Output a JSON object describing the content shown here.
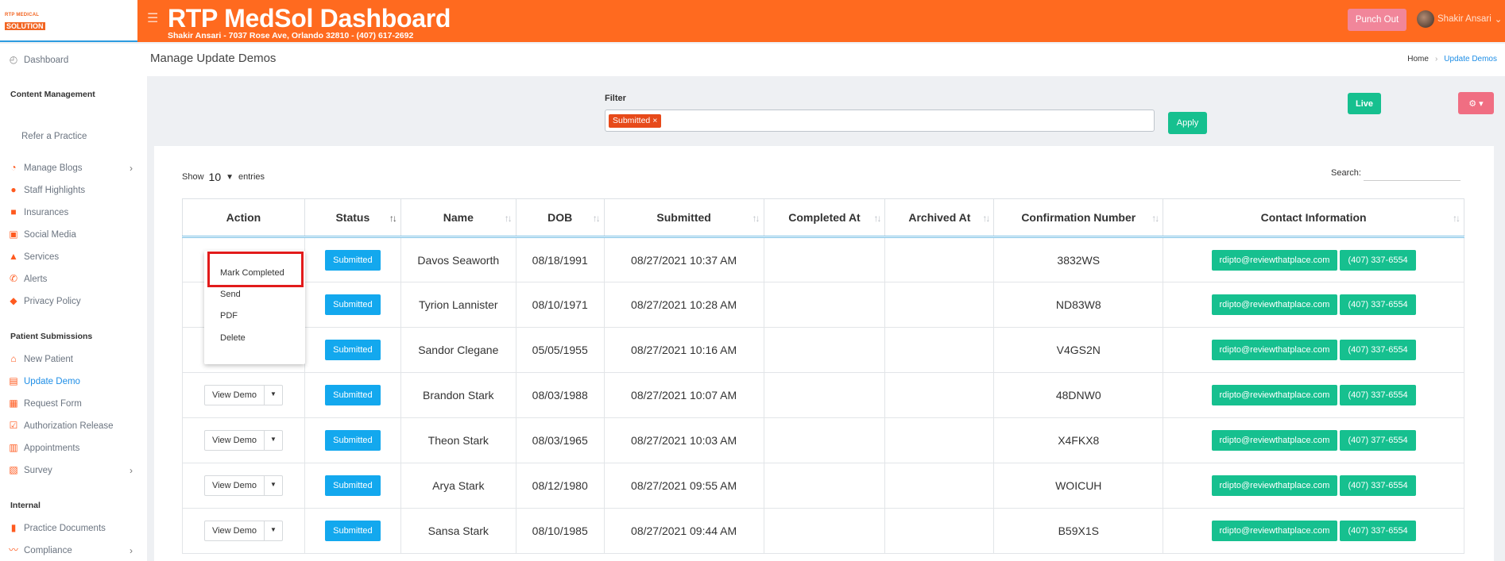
{
  "brand": {
    "logo_top": "RTP MEDICAL",
    "logo_bottom": "SOLUTION",
    "primary_color": "#ff6a1f",
    "accent_blue": "#1e8ee6",
    "green": "#16c08f"
  },
  "header": {
    "title": "RTP MedSol Dashboard",
    "subtitle": "Shakir Ansari - 7037 Rose Ave, Orlando 32810 - (407) 617-2692",
    "punch_label": "Punch Out",
    "user_name": "Shakir Ansari"
  },
  "sidebar": {
    "dashboard": "Dashboard",
    "section_content": "Content Management",
    "refer": "Refer a Practice",
    "items_content": [
      "Manage Blogs",
      "Staff Highlights",
      "Insurances",
      "Social Media",
      "Services",
      "Alerts",
      "Privacy Policy"
    ],
    "section_patient": "Patient Submissions",
    "items_patient": [
      "New Patient",
      "Update Demo",
      "Request Form",
      "Authorization Release",
      "Appointments",
      "Survey"
    ],
    "section_internal": "Internal",
    "items_internal": [
      "Practice Documents",
      "Compliance"
    ]
  },
  "page": {
    "title": "Manage Update Demos",
    "breadcrumb": [
      "Home",
      "Update Demos"
    ]
  },
  "filter": {
    "label": "Filter",
    "tag": "Submitted ×",
    "apply": "Apply",
    "live": "Live",
    "gear": "⚙ ▾"
  },
  "table_controls": {
    "show": "Show",
    "entries_value": "10",
    "entries": "entries",
    "search_label": "Search:"
  },
  "table": {
    "columns": [
      "Action",
      "Status",
      "Name",
      "DOB",
      "Submitted",
      "Completed At",
      "Archived At",
      "Confirmation Number",
      "Contact Information"
    ],
    "view_label": "View Demo",
    "rows": [
      {
        "status": "Submitted",
        "name": "Davos Seaworth",
        "dob": "08/18/1991",
        "submitted": "08/27/2021 10:37 AM",
        "completed": "",
        "archived": "",
        "conf": "3832WS",
        "email": "rdipto@reviewthatplace.com",
        "phone": "(407) 337-6554"
      },
      {
        "status": "Submitted",
        "name": "Tyrion Lannister",
        "dob": "08/10/1971",
        "submitted": "08/27/2021 10:28 AM",
        "completed": "",
        "archived": "",
        "conf": "ND83W8",
        "email": "rdipto@reviewthatplace.com",
        "phone": "(407) 337-6554"
      },
      {
        "status": "Submitted",
        "name": "Sandor Clegane",
        "dob": "05/05/1955",
        "submitted": "08/27/2021 10:16 AM",
        "completed": "",
        "archived": "",
        "conf": "V4GS2N",
        "email": "rdipto@reviewthatplace.com",
        "phone": "(407) 337-6554"
      },
      {
        "status": "Submitted",
        "name": "Brandon Stark",
        "dob": "08/03/1988",
        "submitted": "08/27/2021 10:07 AM",
        "completed": "",
        "archived": "",
        "conf": "48DNW0",
        "email": "rdipto@reviewthatplace.com",
        "phone": "(407) 337-6554"
      },
      {
        "status": "Submitted",
        "name": "Theon Stark",
        "dob": "08/03/1965",
        "submitted": "08/27/2021 10:03 AM",
        "completed": "",
        "archived": "",
        "conf": "X4FKX8",
        "email": "rdipto@reviewthatplace.com",
        "phone": "(407) 377-6554"
      },
      {
        "status": "Submitted",
        "name": "Arya Stark",
        "dob": "08/12/1980",
        "submitted": "08/27/2021 09:55 AM",
        "completed": "",
        "archived": "",
        "conf": "WOICUH",
        "email": "rdipto@reviewthatplace.com",
        "phone": "(407) 337-6554"
      },
      {
        "status": "Submitted",
        "name": "Sansa Stark",
        "dob": "08/10/1985",
        "submitted": "08/27/2021 09:44 AM",
        "completed": "",
        "archived": "",
        "conf": "B59X1S",
        "email": "rdipto@reviewthatplace.com",
        "phone": "(407) 337-6554"
      }
    ]
  },
  "dropdown": {
    "items": [
      "Mark Completed",
      "Send",
      "PDF",
      "Delete"
    ]
  }
}
